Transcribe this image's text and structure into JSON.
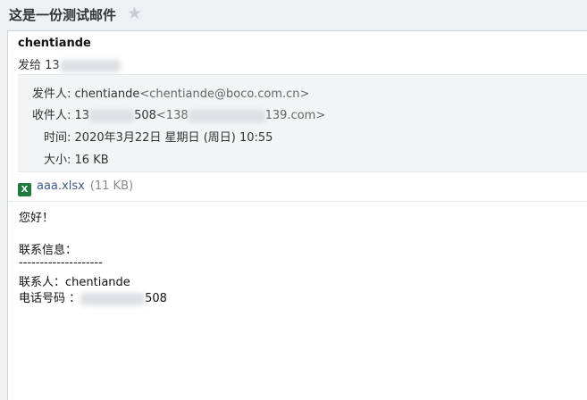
{
  "header": {
    "subject": "这是一份测试邮件",
    "star_icon": "star-icon"
  },
  "message": {
    "sender_name": "chentiande",
    "recipient_prefix": "发给 13",
    "recipient_suffix": "",
    "details": {
      "from_label": "发件人:",
      "from_name": "chentiande",
      "from_address": "<chentiande@boco.com.cn>",
      "to_label": "收件人:",
      "to_prefix": "13",
      "to_suffix": "508",
      "to_addr_prefix": "<138",
      "to_addr_suffix": "139.com>",
      "time_label": "时间:",
      "time_value": "2020年3月22日 星期日 (周日) 10:55",
      "size_label": "大小:",
      "size_value": "16 KB"
    },
    "attachment": {
      "icon": "excel-file-icon",
      "icon_glyph": "X",
      "name": "aaa.xlsx",
      "size": "(11 KB)"
    },
    "body": {
      "greeting": "您好！",
      "contact_heading": "联系信息：",
      "separator": "--------------------",
      "contact_person": "联系人：chentiande",
      "phone_prefix": "电话号码 ：",
      "phone_suffix": "508"
    }
  }
}
